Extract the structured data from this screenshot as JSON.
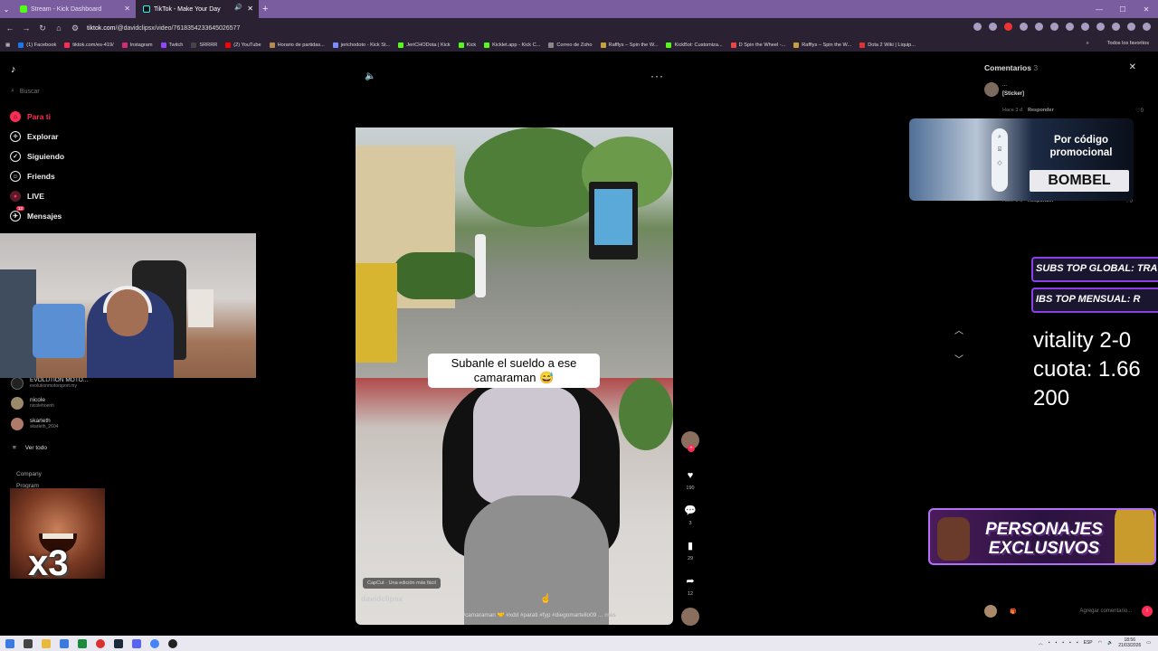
{
  "browser": {
    "tabs": [
      {
        "label": "Stream - Kick Dashboard",
        "active": false
      },
      {
        "label": "TikTok - Make Your Day",
        "active": true
      }
    ],
    "url_host": "tiktok.com",
    "url_path": "/@davidclipsx/video/7618354233645026577",
    "bookmarks": [
      "(1) Facebook",
      "tiktok.com/es-419/",
      "Instagram",
      "Twitch",
      "SRRRR",
      "(2) YouTube",
      "Horario de partidas...",
      "jerichodoto - Kick St...",
      "JeriCHODota | Kick",
      "Kick",
      "Kicklet.app - Kick C...",
      "Correo de Zoho",
      "Rafflys – Spin the W...",
      "KickBot: Customiza...",
      "D Spin the Wheel -...",
      "Rafflys – Spin the W...",
      "Dota 2 Wiki | Liquip..."
    ],
    "bookmarks_all": "Todos los favoritos"
  },
  "sidebar": {
    "search_placeholder": "Buscar",
    "nav": [
      {
        "label": "Para ti",
        "icon": "home-icon"
      },
      {
        "label": "Explorar",
        "icon": "compass-icon"
      },
      {
        "label": "Siguiendo",
        "icon": "following-icon"
      },
      {
        "label": "Friends",
        "icon": "friends-icon"
      },
      {
        "label": "LIVE",
        "icon": "live-icon"
      },
      {
        "label": "Mensajes",
        "icon": "messages-icon"
      }
    ],
    "messages_badge": "13",
    "accounts": [
      {
        "name": "EVOLUTION MOTO...",
        "handle": "evolutionmotorsport.my"
      },
      {
        "name": "nicole",
        "handle": "nicolehoenh"
      },
      {
        "name": "skarleth",
        "handle": "skarleth_2604"
      }
    ],
    "see_all": "Ver todo",
    "company": "Company",
    "program": "Program"
  },
  "meme": {
    "text": "x3"
  },
  "video": {
    "caption": "Subanle el sueldo a ese camaraman 😅",
    "capcut": "CapCut · Una edición más fácil",
    "author": "davidclipsx",
    "description": "Se pasó de frio pa regresar #viralvideo #camaraman 🤝 #xdd #parati #fyp #diegomartello09 ...",
    "more": "más"
  },
  "actions": {
    "likes": "190",
    "comments": "3",
    "saves": "29",
    "shares": "12"
  },
  "comments": {
    "title": "Comentarios",
    "count": "3",
    "first": {
      "user": "...",
      "text": "[Sticker]",
      "time": "Hace 3 d",
      "reply": "Responder",
      "likes": "0"
    },
    "second": {
      "time": "Hace 3 d",
      "reply": "Responder",
      "likes": "0"
    },
    "input_placeholder": "Agregar comentario..."
  },
  "promo": {
    "title": "Por código promocional",
    "code": "BOMBEL"
  },
  "overlays": {
    "banner1": "SUBS TOP GLOBAL: TRAG",
    "banner2": "IBS        TOP MENSUAL: R",
    "stats": [
      "vitality 2-0",
      "cuota: 1.66",
      "200"
    ],
    "personajes": "PERSONAJES EXCLUSIVOS"
  },
  "taskbar": {
    "lang": "ESP",
    "time": "18:56",
    "date": "21/03/2026"
  },
  "colors": {
    "accent": "#fe2c55",
    "tabbar": "#7a5d9e",
    "chrome": "#2a2232",
    "promo_border": "#b36ff5"
  }
}
